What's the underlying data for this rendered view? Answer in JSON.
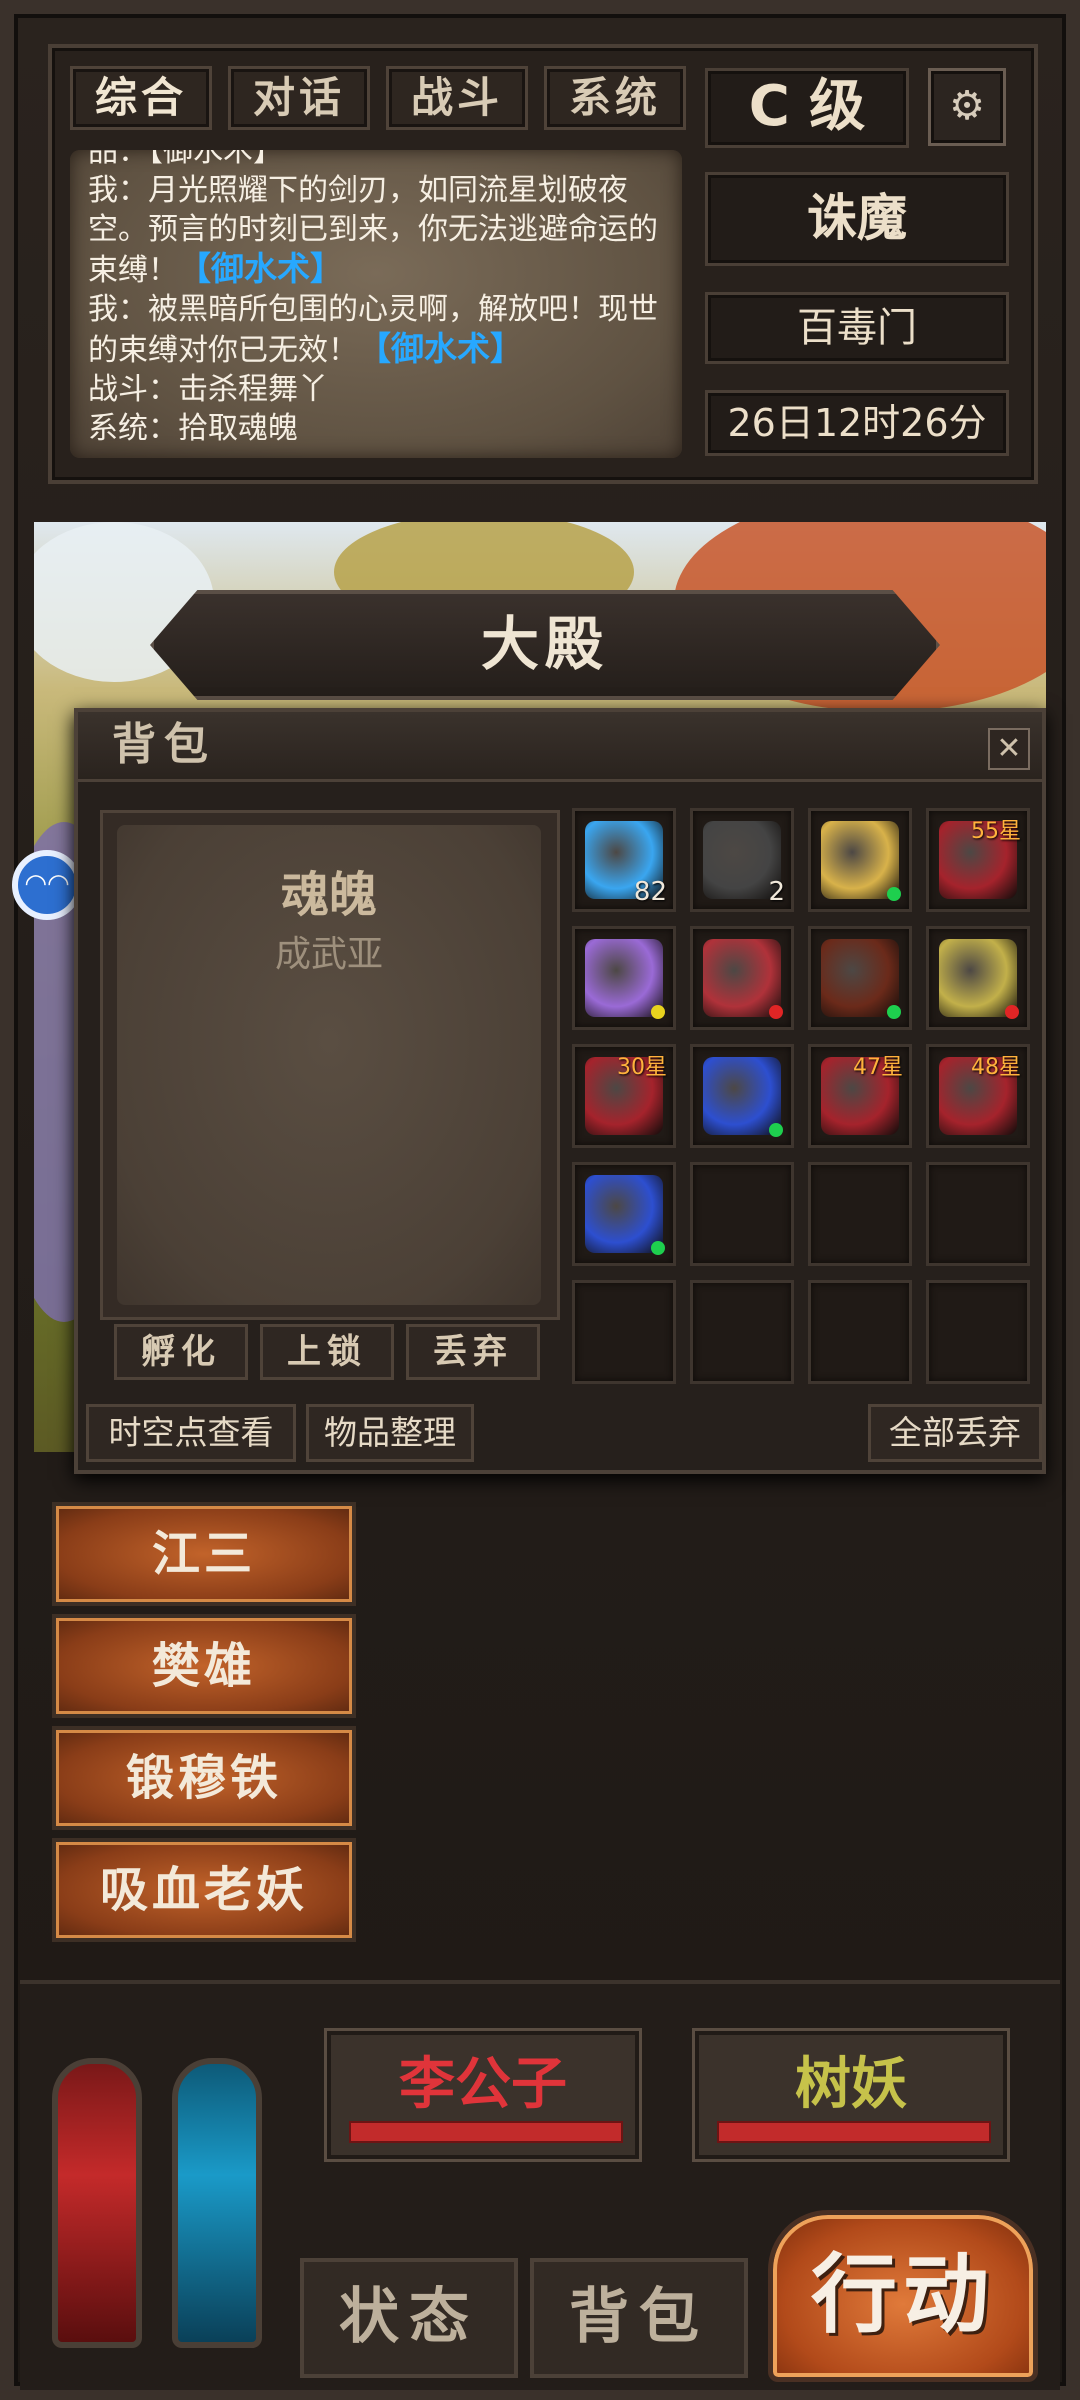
{
  "tabs": [
    "综合",
    "对话",
    "战斗",
    "系统"
  ],
  "log": {
    "cut_line": "品：【御水术】",
    "lines": [
      {
        "prefix": "我：月光照耀下的剑刃，如同流星划破夜空。预言的时刻已到来，你无法逃避命运的束缚！",
        "spell": "【御水术】"
      },
      {
        "prefix": "我：被黑暗所包围的心灵啊，解放吧！现世的束缚对你已无效！",
        "spell": "【御水术】"
      },
      {
        "prefix": "战斗：击杀程舞丫",
        "spell": ""
      },
      {
        "prefix": "系统：拾取魂魄",
        "spell": ""
      }
    ]
  },
  "rank": "C 级",
  "settings_icon": "gear-icon",
  "quest": "诛魔",
  "sect": "百毒门",
  "time": "26日12时26分",
  "location": "大殿",
  "bag": {
    "title": "背包",
    "close_icon": "close-icon",
    "detail_name": "魂魄",
    "detail_sub": "成武亚",
    "actions": [
      "孵化",
      "上锁",
      "丢弃"
    ],
    "footer": [
      "时空点查看",
      "物品整理",
      "全部丢弃"
    ],
    "items": [
      {
        "icon": "blue-crystal-icon",
        "color": "#3aa6f0",
        "count": "82",
        "star": "",
        "dot": ""
      },
      {
        "icon": "camera-icon",
        "color": "#444",
        "count": "2",
        "star": "",
        "dot": ""
      },
      {
        "icon": "dish-icon",
        "color": "#d8b24a",
        "count": "",
        "star": "",
        "dot": "#1ecf4e"
      },
      {
        "icon": "cannon-icon",
        "color": "#a5232c",
        "count": "",
        "star": "55星",
        "dot": ""
      },
      {
        "icon": "spellbook-icon",
        "color": "#9a6ad6",
        "count": "",
        "star": "",
        "dot": "#e8d21e"
      },
      {
        "icon": "armor-icon",
        "color": "#b0323a",
        "count": "",
        "star": "",
        "dot": "#e02525"
      },
      {
        "icon": "sword-icon",
        "color": "#6b2a1a",
        "count": "",
        "star": "",
        "dot": "#1ecf4e"
      },
      {
        "icon": "snake-icon",
        "color": "#c2b04a",
        "count": "",
        "star": "",
        "dot": "#e02525"
      },
      {
        "icon": "cannon-icon",
        "color": "#a5232c",
        "count": "",
        "star": "30星",
        "dot": ""
      },
      {
        "icon": "blue-flame-icon",
        "color": "#2d4fd0",
        "count": "",
        "star": "",
        "dot": "#1ecf4e"
      },
      {
        "icon": "cannon-icon",
        "color": "#a5232c",
        "count": "",
        "star": "47星",
        "dot": ""
      },
      {
        "icon": "cannon-icon",
        "color": "#a5232c",
        "count": "",
        "star": "48星",
        "dot": ""
      },
      {
        "icon": "blue-flame-icon",
        "color": "#2d4fd0",
        "count": "",
        "star": "",
        "dot": "#1ecf4e"
      }
    ]
  },
  "npcs": [
    "江三",
    "樊雄",
    "锻穆铁",
    "吸血老妖"
  ],
  "targets": [
    {
      "name": "李公子",
      "color": "#e0343a"
    },
    {
      "name": "树妖",
      "color": "#c6c24a"
    }
  ],
  "bottom_buttons": [
    "状态",
    "背包"
  ],
  "action": "行动",
  "colors": {
    "health": "#c42a2a",
    "mana": "#1a9ac8"
  }
}
